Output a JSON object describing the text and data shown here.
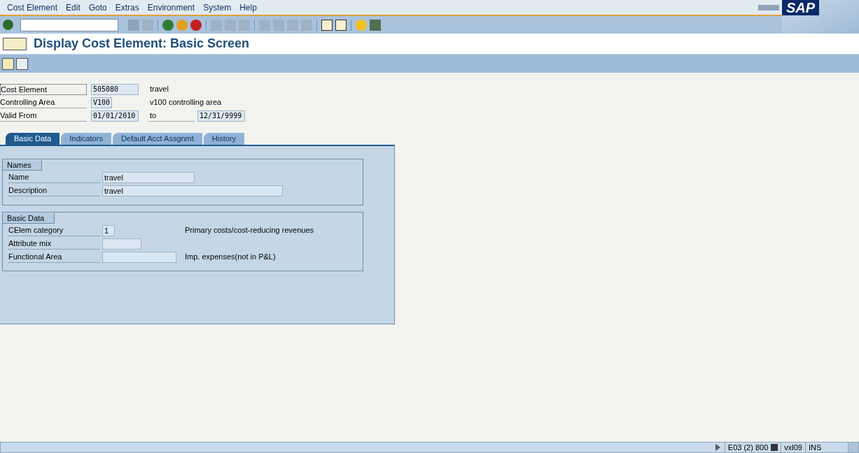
{
  "menu": [
    "Cost Element",
    "Edit",
    "Goto",
    "Extras",
    "Environment",
    "System",
    "Help"
  ],
  "logo": "SAP",
  "title": "Display Cost Element: Basic Screen",
  "header": [
    {
      "label": "Cost Element",
      "value": "505080",
      "text": "travel",
      "focused": true
    },
    {
      "label": "Controlling Area",
      "value": "V100",
      "text": "v100 controlling area",
      "focused": false
    }
  ],
  "validity": {
    "label": "Valid From",
    "value": "01/01/2010",
    "to_label": "to",
    "to_value": "12/31/9999"
  },
  "tabs": [
    {
      "label": "Basic Data",
      "selected": true
    },
    {
      "label": "Indicators",
      "selected": false
    },
    {
      "label": "Default Acct Assgnmt",
      "selected": false
    },
    {
      "label": "History",
      "selected": false
    }
  ],
  "groups": [
    {
      "title": "Names",
      "fields": [
        {
          "label": "Name",
          "value": "travel"
        },
        {
          "label": "Description",
          "value": "travel"
        }
      ]
    },
    {
      "title": "Basic Data",
      "fields": [
        {
          "label": "CElem category",
          "value": "1",
          "text": "Primary costs/cost-reducing revenues"
        },
        {
          "label": "Attribute mix"
        },
        {
          "label": "Functional Area",
          "text": "Imp. expenses(not in P&L)"
        }
      ]
    }
  ],
  "status": {
    "system": "E03 (2) 800",
    "server": "vxl09",
    "mode": "INS"
  }
}
